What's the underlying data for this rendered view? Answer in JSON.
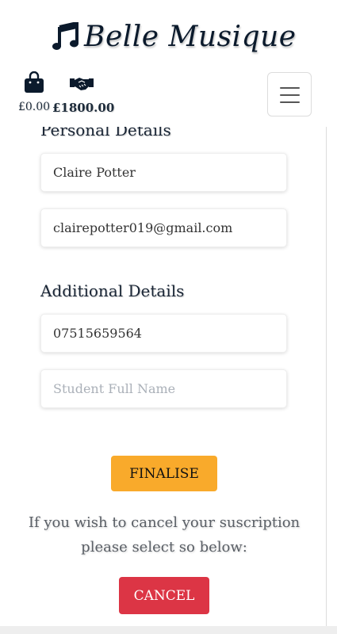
{
  "header": {
    "brand": "Belle Musique",
    "bag_amount": "£0.00",
    "deal_amount": "£1800.00"
  },
  "personal": {
    "title": "Personal Details",
    "name_value": "Claire Potter",
    "email_value": "clairepotter019@gmail.com"
  },
  "additional": {
    "title": "Additional Details",
    "phone_value": "07515659564",
    "student_placeholder": "Student Full Name"
  },
  "actions": {
    "finalise_label": "FINALISE",
    "cancel_note": "If you wish to cancel your suscription please select so below:",
    "cancel_label": "CANCEL"
  },
  "colors": {
    "finalise": "#f9aa2b",
    "cancel": "#dc3545"
  }
}
